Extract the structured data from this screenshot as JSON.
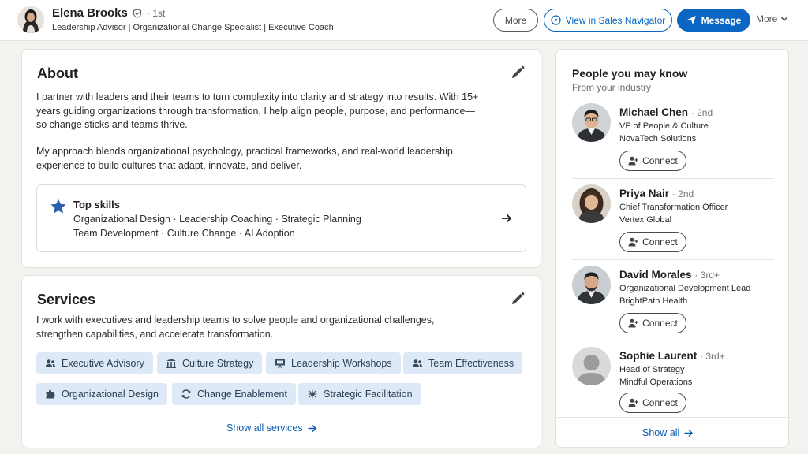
{
  "header": {
    "name": "Elena Brooks",
    "degree": "· 1st",
    "headline": "Leadership Advisor | Organizational Change Specialist | Executive Coach",
    "more_button": "More",
    "sales_nav_button": "View in Sales Navigator",
    "message_button": "Message",
    "more_menu": "More"
  },
  "about": {
    "title": "About",
    "paragraph1_lines": [
      "I partner with leaders and their teams to turn complexity into clarity and strategy into results. With 15+",
      "years guiding organizations through transformation, I help align people, purpose, and performance—",
      "so change sticks and teams thrive."
    ],
    "paragraph2_lines": [
      "My approach blends organizational psychology, practical frameworks, and real-world leadership",
      "experience to build cultures that adapt, innovate, and deliver."
    ],
    "top_skills_title": "Top skills",
    "top_skills_lines": [
      "Organizational Design · Leadership Coaching · Strategic Planning",
      "Team Development · Culture Change · AI Adoption"
    ]
  },
  "services": {
    "title": "Services",
    "description_lines": [
      "I work with executives and leadership teams to solve people and organizational challenges,",
      "strengthen capabilities, and accelerate transformation."
    ],
    "chips": [
      {
        "label": "Executive Advisory",
        "icon": "people-icon"
      },
      {
        "label": "Culture Strategy",
        "icon": "institution-icon"
      },
      {
        "label": "Leadership Workshops",
        "icon": "presentation-icon"
      },
      {
        "label": "Team Effectiveness",
        "icon": "people-icon"
      },
      {
        "label": "Organizational Design",
        "icon": "puzzle-icon"
      },
      {
        "label": "Change Enablement",
        "icon": "refresh-icon"
      },
      {
        "label": "Strategic Facilitation",
        "icon": "sparkle-icon"
      }
    ],
    "show_all": "Show all services"
  },
  "pymk": {
    "title": "People you may know",
    "subtitle": "From your industry",
    "people": [
      {
        "name": "Michael Chen",
        "degree": "· 2nd",
        "role": "VP of People & Culture",
        "company": "NovaTech Solutions",
        "connect": "Connect"
      },
      {
        "name": "Priya Nair",
        "degree": "· 2nd",
        "role": "Chief Transformation Officer",
        "company": "Vertex Global",
        "connect": "Connect"
      },
      {
        "name": "David Morales",
        "degree": "· 3rd+",
        "role": "Organizational Development Lead",
        "company": "BrightPath Health",
        "connect": "Connect"
      },
      {
        "name": "Sophie Laurent",
        "degree": "· 3rd+",
        "role": "Head of Strategy",
        "company": "Mindful Operations",
        "connect": "Connect"
      }
    ],
    "show_all": "Show all"
  },
  "colors": {
    "brand_blue": "#0a66c2",
    "chip_bg": "#dde9f6",
    "page_bg": "#f4f2ee"
  }
}
